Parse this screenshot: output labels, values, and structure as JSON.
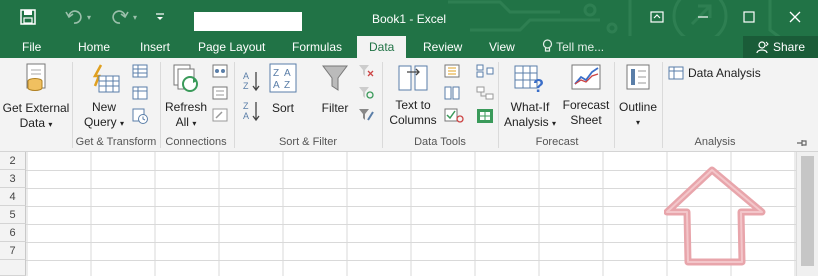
{
  "window": {
    "title": "Book1 - Excel",
    "accent_color": "#217346",
    "name_box_value": ""
  },
  "quick_access": {
    "save_icon": "save-icon",
    "undo_icon": "undo-icon",
    "redo_icon": "redo-icon"
  },
  "tabs": [
    {
      "label": "File"
    },
    {
      "label": "Home"
    },
    {
      "label": "Insert"
    },
    {
      "label": "Page Layout"
    },
    {
      "label": "Formulas"
    },
    {
      "label": "Data",
      "active": true
    },
    {
      "label": "Review"
    },
    {
      "label": "View"
    }
  ],
  "tell_me": {
    "placeholder": "Tell me..."
  },
  "share": {
    "label": "Share"
  },
  "ribbon": {
    "get_external": {
      "line1": "Get External",
      "line2": "Data"
    },
    "new_query": {
      "line1": "New",
      "line2": "Query"
    },
    "refresh": {
      "line1": "Refresh",
      "line2": "All"
    },
    "sort": {
      "label": "Sort"
    },
    "filter": {
      "label": "Filter"
    },
    "text_to_columns": {
      "line1": "Text to",
      "line2": "Columns"
    },
    "what_if": {
      "line1": "What-If",
      "line2": "Analysis"
    },
    "forecast_sheet": {
      "line1": "Forecast",
      "line2": "Sheet"
    },
    "outline": {
      "label": "Outline"
    },
    "data_analysis": {
      "label": "Data Analysis"
    },
    "groups": {
      "get_transform": "Get & Transform",
      "connections": "Connections",
      "sort_filter": "Sort & Filter",
      "data_tools": "Data Tools",
      "forecast": "Forecast",
      "analysis": "Analysis"
    }
  },
  "sheet": {
    "row_numbers": [
      "2",
      "3",
      "4",
      "5",
      "6",
      "7"
    ],
    "annotation_color": "#e8a5ab"
  }
}
